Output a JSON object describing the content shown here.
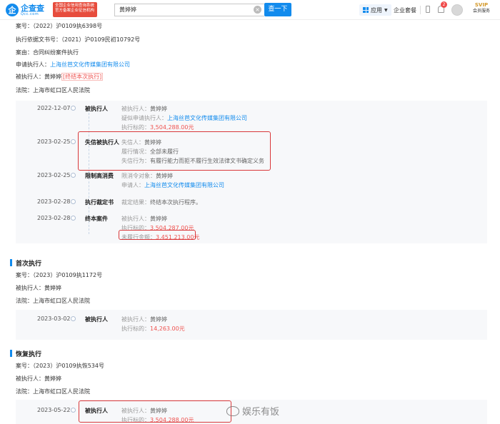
{
  "header": {
    "logo_main": "企查查",
    "logo_sub": "Qcc.com",
    "badge_line1": "全国企业信用查询系统",
    "badge_line2": "官方备案企业征信机构",
    "search_value": "黄婷婷",
    "search_button": "查一下",
    "app_label": "应用",
    "kit_label": "企业套餐",
    "notification_count": "2",
    "vip_top": "SVIP",
    "vip_bottom": "会员服务"
  },
  "case": {
    "case_no_label": "案号：",
    "case_no": "（2022）沪0109执6398号",
    "basis_label": "执行依据文书号：",
    "basis": "（2021）沪0109民初10792号",
    "cause_label": "案由：",
    "cause": "合同纠纷案件执行",
    "applicant_label": "申请执行人：",
    "applicant": "上海丝芭文化传媒集团有限公司",
    "executed_label": "被执行人：",
    "executed": "黄婷婷",
    "executed_tag": "[终结本次执行]",
    "court_label": "法院：",
    "court": "上海市虹口区人民法院"
  },
  "timeline1": [
    {
      "date": "2022-12-07",
      "event": "被执行人",
      "lines": [
        {
          "label": "被执行人：",
          "value": "黄婷婷",
          "style": "v"
        },
        {
          "label": "疑似申请执行人：",
          "value": "上海丝芭文化传媒集团有限公司",
          "style": "link"
        },
        {
          "label": "执行标的：",
          "value": "3,504,288.00元",
          "style": "amt"
        }
      ]
    },
    {
      "date": "2023-02-25",
      "event": "失信被执行人",
      "lines": [
        {
          "label": "失信人：",
          "value": "黄婷婷",
          "style": "v"
        },
        {
          "label": "履行情况：",
          "value": "全部未履行",
          "style": "v"
        },
        {
          "label": "失信行为：",
          "value": "有履行能力而拒不履行生效法律文书确定义务",
          "style": "v"
        }
      ]
    },
    {
      "date": "2023-02-25",
      "event": "限制高消费",
      "lines": [
        {
          "label": "限消令对象：",
          "value": "黄婷婷",
          "style": "v"
        },
        {
          "label": "申请人：",
          "value": "上海丝芭文化传媒集团有限公司",
          "style": "link"
        }
      ]
    },
    {
      "date": "2023-02-28",
      "event": "执行裁定书",
      "lines": [
        {
          "label": "裁定结果：",
          "value": "终结本次执行程序。",
          "style": "v"
        }
      ]
    },
    {
      "date": "2023-02-28",
      "event": "终本案件",
      "lines": [
        {
          "label": "被执行人：",
          "value": "黄婷婷",
          "style": "v"
        },
        {
          "label": "执行标的：",
          "value": "3,504,287.00元",
          "style": "amt"
        },
        {
          "label": "未履行金额：",
          "value": "3,451,213.00元",
          "style": "amt"
        }
      ]
    }
  ],
  "section2": {
    "title": "首次执行",
    "case_no_label": "案号：",
    "case_no": "（2023）沪0109执1172号",
    "executed_label": "被执行人：",
    "executed": "黄婷婷",
    "court_label": "法院：",
    "court": "上海市虹口区人民法院",
    "event": {
      "date": "2023-03-02",
      "event": "被执行人",
      "lines": [
        {
          "label": "被执行人：",
          "value": "黄婷婷",
          "style": "v"
        },
        {
          "label": "执行标的：",
          "value": "14,263.00元",
          "style": "amt"
        }
      ]
    }
  },
  "section3": {
    "title": "恢复执行",
    "case_no_label": "案号：",
    "case_no": "（2023）沪0109执恢534号",
    "executed_label": "被执行人：",
    "executed": "黄婷婷",
    "court_label": "法院：",
    "court": "上海市虹口区人民法院",
    "event": {
      "date": "2023-05-22",
      "event": "被执行人",
      "lines": [
        {
          "label": "被执行人：",
          "value": "黄婷婷",
          "style": "v"
        },
        {
          "label": "执行标的：",
          "value": "3,504,288.00元",
          "style": "amt"
        }
      ]
    }
  },
  "watermark": "娱乐有饭"
}
